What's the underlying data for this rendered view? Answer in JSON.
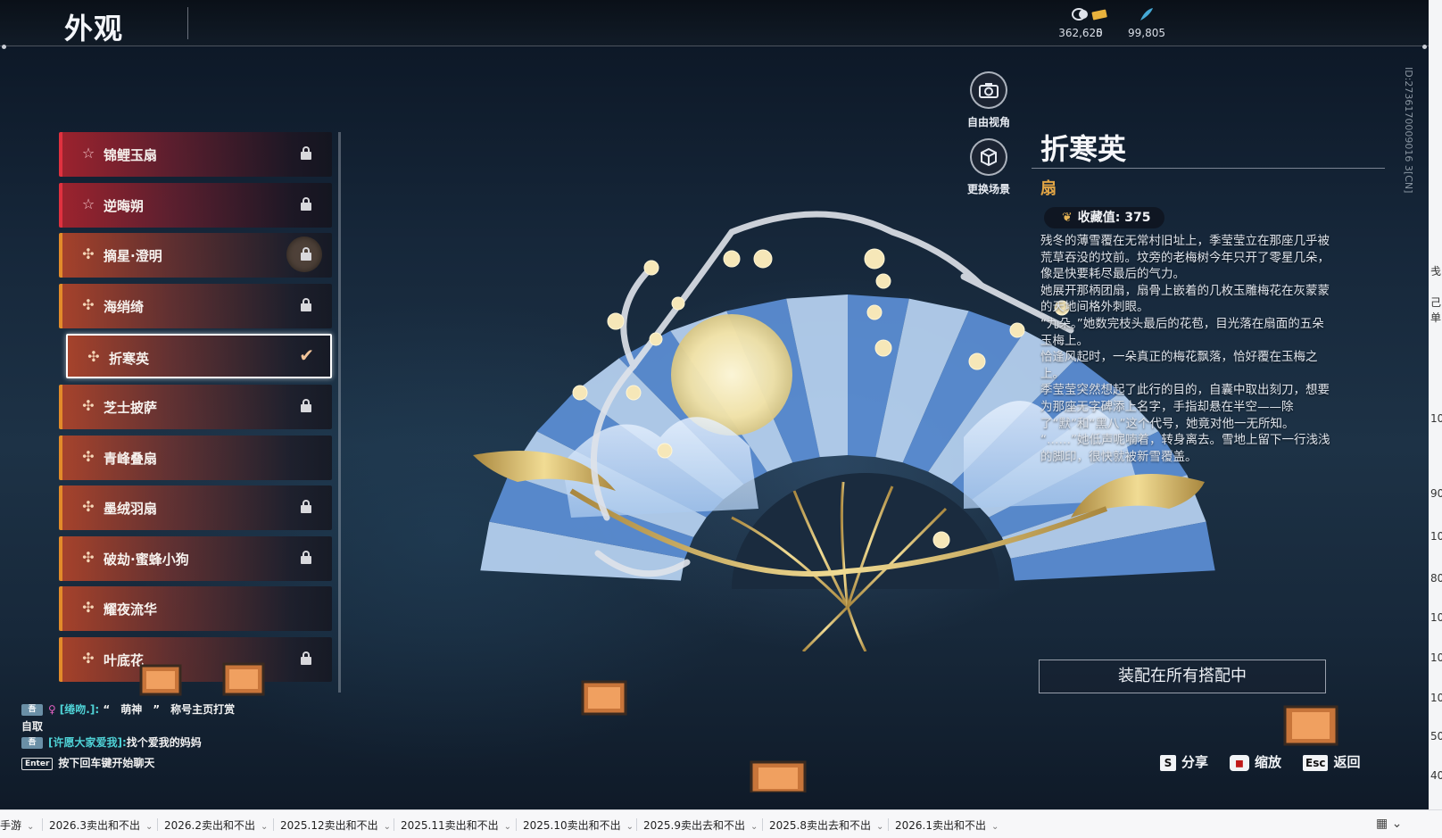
{
  "header": {
    "title": "外观",
    "currencies": [
      {
        "icon": "coin-icon",
        "value": "362,625"
      },
      {
        "icon": "ticket-icon",
        "value": "0"
      },
      {
        "icon": "feather-icon",
        "value": "99,805"
      }
    ]
  },
  "id_text": "ID:2736170009016 3[CN]",
  "items": [
    {
      "label": "锦鲤玉扇",
      "rarity": "red",
      "locked": true
    },
    {
      "label": "逆晦朔",
      "rarity": "red",
      "locked": true
    },
    {
      "label": "摘星·澄明",
      "rarity": "orange",
      "locked": true
    },
    {
      "label": "海绡绮",
      "rarity": "orange",
      "locked": true
    },
    {
      "label": "折寒英",
      "rarity": "orange",
      "locked": false,
      "selected": true
    },
    {
      "label": "芝士披萨",
      "rarity": "orange",
      "locked": true
    },
    {
      "label": "青峰叠扇",
      "rarity": "orange",
      "locked": false
    },
    {
      "label": "墨绒羽扇",
      "rarity": "orange",
      "locked": true
    },
    {
      "label": "破劫·蜜蜂小狗",
      "rarity": "orange",
      "locked": true
    },
    {
      "label": "耀夜流华",
      "rarity": "orange",
      "locked": false
    },
    {
      "label": "叶底花",
      "rarity": "orange",
      "locked": true
    }
  ],
  "camera": {
    "free_view": "自由视角",
    "change_scene": "更换场景"
  },
  "detail": {
    "title": "折寒英",
    "type": "扇",
    "collect_label": "收藏值: 375",
    "paragraphs": [
      "残冬的薄雪覆在无常村旧址上，季莹莹立在那座几乎被荒草吞没的坟前。坟旁的老梅树今年只开了零星几朵，像是快要耗尽最后的气力。",
      "她展开那柄团扇，扇骨上嵌着的几枚玉雕梅花在灰蒙蒙的天地间格外刺眼。",
      "“九朵。”她数完枝头最后的花苞，目光落在扇面的五朵玉梅上。",
      "恰逢风起时，一朵真正的梅花飘落，恰好覆在玉梅之上。",
      "季莹莹突然想起了此行的目的，自囊中取出刻刀，想要为那座无字碑添上名字，手指却悬在半空——除了“默”和“黑八”这个代号，她竟对他一无所知。",
      "“……”她低声呢喃着，转身离去。雪地上留下一行浅浅的脚印，很快就被新雪覆盖。"
    ],
    "equip_label": "装配在所有搭配中"
  },
  "chat": {
    "line1_tag": "吾",
    "line1_name": "[绻吻.]:",
    "line1_text": "“　萌神　”　称号主页打赏",
    "line2_text": "自取",
    "line3_tag": "吾",
    "line3_name": "[许愿大家爱我]:",
    "line3_text": "找个爱我的妈妈",
    "prompt_key": "Enter",
    "prompt_text": "按下回车键开始聊天"
  },
  "hints": [
    {
      "key": "S",
      "label": "分享"
    },
    {
      "key": "zoom-icon",
      "label": "缩放"
    },
    {
      "key": "Esc",
      "label": "返回"
    }
  ],
  "sheet_tabs": [
    "手游",
    "2026.3卖出和不出",
    "2026.2卖出和不出",
    "2025.12卖出和不出",
    "2025.11卖出和不出",
    "2025.10卖出和不出",
    "2025.9卖出去和不出",
    "2025.8卖出去和不出",
    "2026.1卖出和不出"
  ],
  "right_strip": [
    "戋",
    "己单",
    "10",
    "90",
    "10",
    "80",
    "10",
    "10",
    "10",
    "50",
    "40"
  ]
}
